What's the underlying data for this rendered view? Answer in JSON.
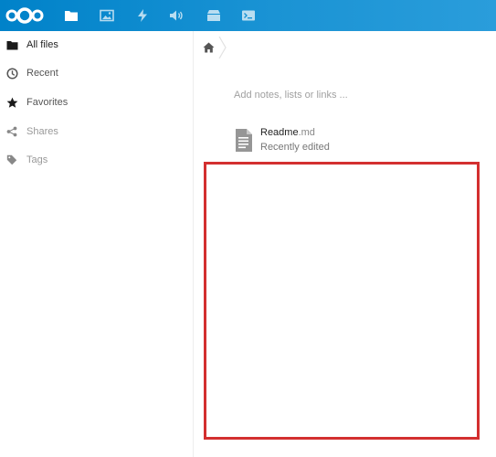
{
  "header": {
    "logo_icon": "nextcloud-logo",
    "background": "#0082c9",
    "apps": [
      {
        "icon": "folder-icon",
        "active": true
      },
      {
        "icon": "image-icon"
      },
      {
        "icon": "lightning-icon"
      },
      {
        "icon": "volume-icon"
      },
      {
        "icon": "archive-icon"
      },
      {
        "icon": "terminal-icon"
      }
    ]
  },
  "sidebar": {
    "items": [
      {
        "label": "All files",
        "icon": "folder-icon",
        "active": true
      },
      {
        "label": "Recent",
        "icon": "clock-icon"
      },
      {
        "label": "Favorites",
        "icon": "star-icon"
      },
      {
        "label": "Shares",
        "icon": "share-icon"
      },
      {
        "label": "Tags",
        "icon": "tag-icon"
      }
    ]
  },
  "main": {
    "breadcrumb": {
      "home_icon": "home-icon"
    },
    "notes_placeholder": "Add notes, lists or links ...",
    "recent_file": {
      "name": "Readme",
      "ext": ".md",
      "status": "Recently edited",
      "icon": "text-file-icon"
    }
  },
  "annotation": {
    "color": "#d32f2f"
  }
}
